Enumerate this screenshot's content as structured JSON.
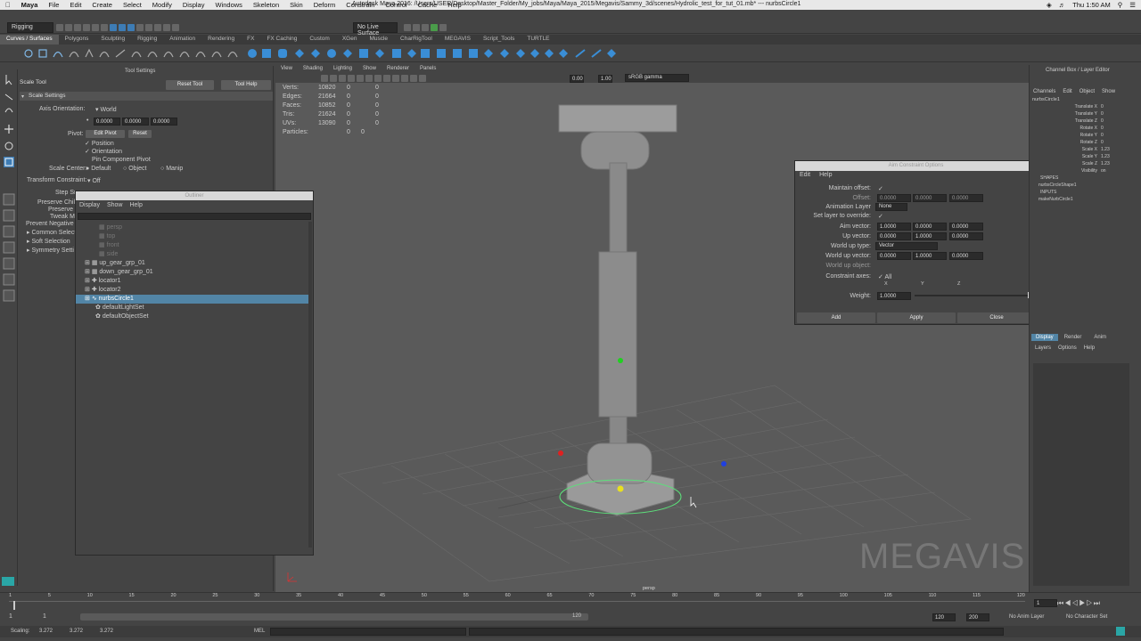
{
  "menubar": {
    "items": [
      "Maya",
      "File",
      "Edit",
      "Create",
      "Select",
      "Modify",
      "Display",
      "Windows",
      "Skeleton",
      "Skin",
      "Deform",
      "Constrain",
      "Control",
      "Cache",
      "Help"
    ],
    "title": "Autodesk Maya 2016: /Users/USER/Desktop/Master_Folder/My_jobs/Maya/Maya_2015/Megavis/Sammy_3d/scenes/Hydrolic_test_for_tut_01.mb* --- nurbsCircle1",
    "time": "Thu 1:50 AM"
  },
  "statusline": {
    "menuset": "Rigging",
    "live_surface": "No Live Surface"
  },
  "shelf_tabs": [
    "Curves / Surfaces",
    "Polygons",
    "Sculpting",
    "Rigging",
    "Animation",
    "Rendering",
    "FX",
    "FX Caching",
    "Custom",
    "XGen",
    "Muscle",
    "CharRigTool",
    "MEGAVIS",
    "Script_Tools",
    "TURTLE"
  ],
  "tool_settings": {
    "header": "Tool Settings",
    "tool_name": "Scale Tool",
    "reset_tool": "Reset Tool",
    "tool_help": "Tool Help",
    "section_scale": "Scale Settings",
    "axis_orientation_label": "Axis Orientation:",
    "axis_orientation_value": "World",
    "xyz": [
      "0.0000",
      "0.0000",
      "0.0000"
    ],
    "pivot_label": "Pivot:",
    "edit_pivot": "Edit Pivot",
    "reset": "Reset",
    "position": "Position",
    "orientation": "Orientation",
    "pin_component_pivot": "Pin Component Pivot",
    "scale_center_label": "Scale Center:",
    "scale_center_opts": [
      "Default",
      "Object",
      "Manip"
    ],
    "transform_constraint_label": "Transform Constraint:",
    "transform_constraint_value": "Off",
    "step_snap": "Step Sn",
    "preserve_child": "Preserve Child",
    "preserve_u": "Preserve U",
    "tweak_mo": "Tweak Mo",
    "prevent_negative": "Prevent Negative Sc",
    "sections": [
      "Common Selecti",
      "Soft Selection",
      "Symmetry Setti"
    ]
  },
  "outliner": {
    "title": "Outliner",
    "menu": [
      "Display",
      "Show",
      "Help"
    ],
    "items": [
      {
        "label": "persp",
        "dim": true,
        "indent": 0
      },
      {
        "label": "top",
        "dim": true,
        "indent": 0
      },
      {
        "label": "front",
        "dim": true,
        "indent": 0
      },
      {
        "label": "side",
        "dim": true,
        "indent": 0
      },
      {
        "label": "up_gear_grp_01",
        "dim": false,
        "indent": 1
      },
      {
        "label": "down_gear_grp_01",
        "dim": false,
        "indent": 1
      },
      {
        "label": "locator1",
        "dim": false,
        "indent": 1
      },
      {
        "label": "locator2",
        "dim": false,
        "indent": 1
      },
      {
        "label": "nurbsCircle1",
        "dim": false,
        "indent": 1,
        "selected": true
      },
      {
        "label": "defaultLightSet",
        "dim": false,
        "indent": 0
      },
      {
        "label": "defaultObjectSet",
        "dim": false,
        "indent": 0
      }
    ]
  },
  "viewport": {
    "menu": [
      "View",
      "Shading",
      "Lighting",
      "Show",
      "Renderer",
      "Panels"
    ],
    "field1": "0.00",
    "field2": "1.00",
    "colorspace": "sRGB gamma",
    "camera": "persp",
    "hud": [
      {
        "label": "Verts:",
        "v1": "10820",
        "v2": "0",
        "v3": "0"
      },
      {
        "label": "Edges:",
        "v1": "21664",
        "v2": "0",
        "v3": "0"
      },
      {
        "label": "Faces:",
        "v1": "10852",
        "v2": "0",
        "v3": "0"
      },
      {
        "label": "Tris:",
        "v1": "21624",
        "v2": "0",
        "v3": "0"
      },
      {
        "label": "UVs:",
        "v1": "13090",
        "v2": "0",
        "v3": "0"
      },
      {
        "label": "Particles:",
        "v1": "0",
        "v2": "0",
        "v3": ""
      }
    ],
    "watermark": "MEGAVIS"
  },
  "aim_dialog": {
    "title": "Aim Constraint Options",
    "menu": [
      "Edit",
      "Help"
    ],
    "maintain_offset": "Maintain offset:",
    "offset": "Offset:",
    "offset_vals": [
      "0.0000",
      "0.0000",
      "0.0000"
    ],
    "animation_layer": "Animation Layer",
    "animation_layer_value": "None",
    "set_layer_override": "Set layer to override:",
    "aim_vector": "Aim vector:",
    "aim_vals": [
      "1.0000",
      "0.0000",
      "0.0000"
    ],
    "up_vector": "Up vector:",
    "up_vals": [
      "0.0000",
      "1.0000",
      "0.0000"
    ],
    "world_up_type": "World up type:",
    "world_up_type_value": "Vector",
    "world_up_vector": "World up vector:",
    "world_up_vals": [
      "0.0000",
      "1.0000",
      "0.0000"
    ],
    "world_up_object": "World up object:",
    "constraint_axes": "Constraint axes:",
    "all": "All",
    "axes": [
      "X",
      "Y",
      "Z"
    ],
    "weight": "Weight:",
    "weight_value": "1.0000",
    "add": "Add",
    "apply": "Apply",
    "close": "Close"
  },
  "channel_box": {
    "title": "Channel Box / Layer Editor",
    "menu": [
      "Channels",
      "Edit",
      "Object",
      "Show"
    ],
    "object": "nurbsCircle1",
    "attrs": [
      {
        "name": "Translate X",
        "value": "0"
      },
      {
        "name": "Translate Y",
        "value": "0"
      },
      {
        "name": "Translate Z",
        "value": "0"
      },
      {
        "name": "Rotate X",
        "value": "0"
      },
      {
        "name": "Rotate Y",
        "value": "0"
      },
      {
        "name": "Rotate Z",
        "value": "0"
      },
      {
        "name": "Scale X",
        "value": "1.23"
      },
      {
        "name": "Scale Y",
        "value": "1.23"
      },
      {
        "name": "Scale Z",
        "value": "1.23"
      },
      {
        "name": "Visibility",
        "value": "on"
      }
    ],
    "shapes_header": "SHAPES",
    "shape": "nurbsCircleShape1",
    "inputs_header": "INPUTS",
    "input": "makeNurbCircle1",
    "layer_tabs": [
      "Display",
      "Render",
      "Anim"
    ],
    "layer_menu": [
      "Layers",
      "Options",
      "Help"
    ]
  },
  "time": {
    "ticks": [
      "1",
      "5",
      "10",
      "15",
      "20",
      "25",
      "30",
      "35",
      "40",
      "45",
      "50",
      "55",
      "60",
      "65",
      "70",
      "75",
      "80",
      "85",
      "90",
      "95",
      "100",
      "105",
      "110",
      "115",
      "120"
    ],
    "current": "1",
    "start": "1",
    "start2": "1",
    "range_mid": "120",
    "end1": "120",
    "end2": "200",
    "anim_layer": "No Anim Layer",
    "char_set": "No Character Set"
  },
  "cmdline": {
    "scaling_label": "Scaling:",
    "scaling_vals": [
      "3.272",
      "3.272",
      "3.272"
    ],
    "mel": "MEL"
  },
  "colors": {
    "selection": "#5285a6",
    "bg": "#444444",
    "viewport": "#5a5a5a"
  }
}
